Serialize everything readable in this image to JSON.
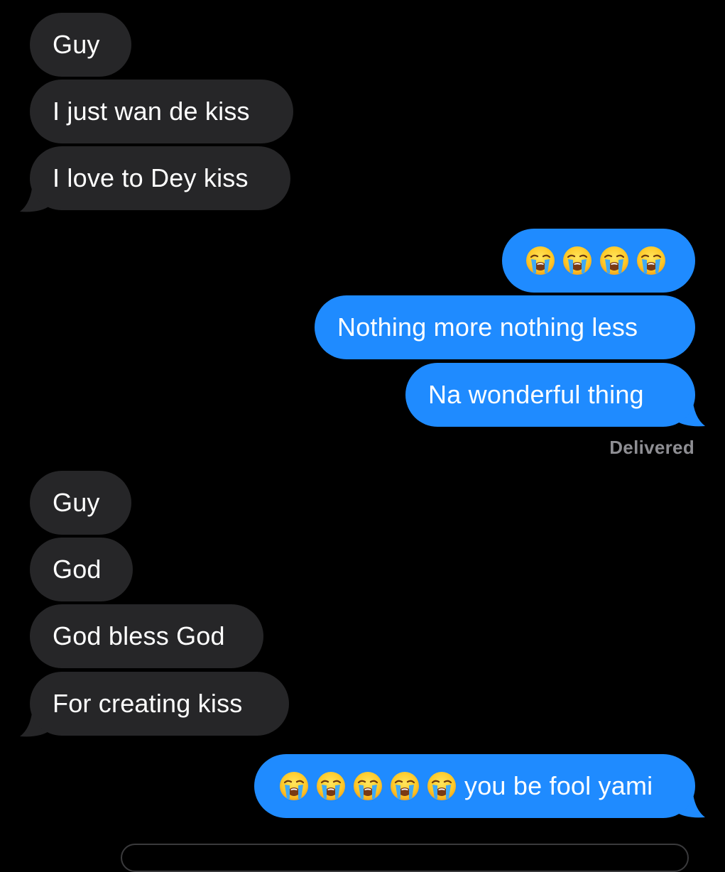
{
  "colors": {
    "background": "#000000",
    "incoming_bubble": "#262628",
    "outgoing_bubble": "#1f8bff",
    "status_text": "#8e8e93"
  },
  "messages": [
    {
      "id": 0,
      "direction": "incoming",
      "text": "Guy"
    },
    {
      "id": 1,
      "direction": "incoming",
      "text": "I just wan de kiss"
    },
    {
      "id": 2,
      "direction": "incoming",
      "text": "I love to Dey kiss"
    },
    {
      "id": 3,
      "direction": "outgoing",
      "emoji": "loudly-crying-face",
      "emoji_count": 4,
      "text": ""
    },
    {
      "id": 4,
      "direction": "outgoing",
      "text": "Nothing more nothing less"
    },
    {
      "id": 5,
      "direction": "outgoing",
      "text": "Na wonderful thing"
    },
    {
      "id": 6,
      "direction": "incoming",
      "text": "Guy"
    },
    {
      "id": 7,
      "direction": "incoming",
      "text": "God"
    },
    {
      "id": 8,
      "direction": "incoming",
      "text": "God bless God"
    },
    {
      "id": 9,
      "direction": "incoming",
      "text": "For creating kiss"
    },
    {
      "id": 10,
      "direction": "outgoing",
      "emoji": "loudly-crying-face",
      "emoji_count": 5,
      "text": "you be fool yami"
    }
  ],
  "status": {
    "delivered_label": "Delivered"
  }
}
